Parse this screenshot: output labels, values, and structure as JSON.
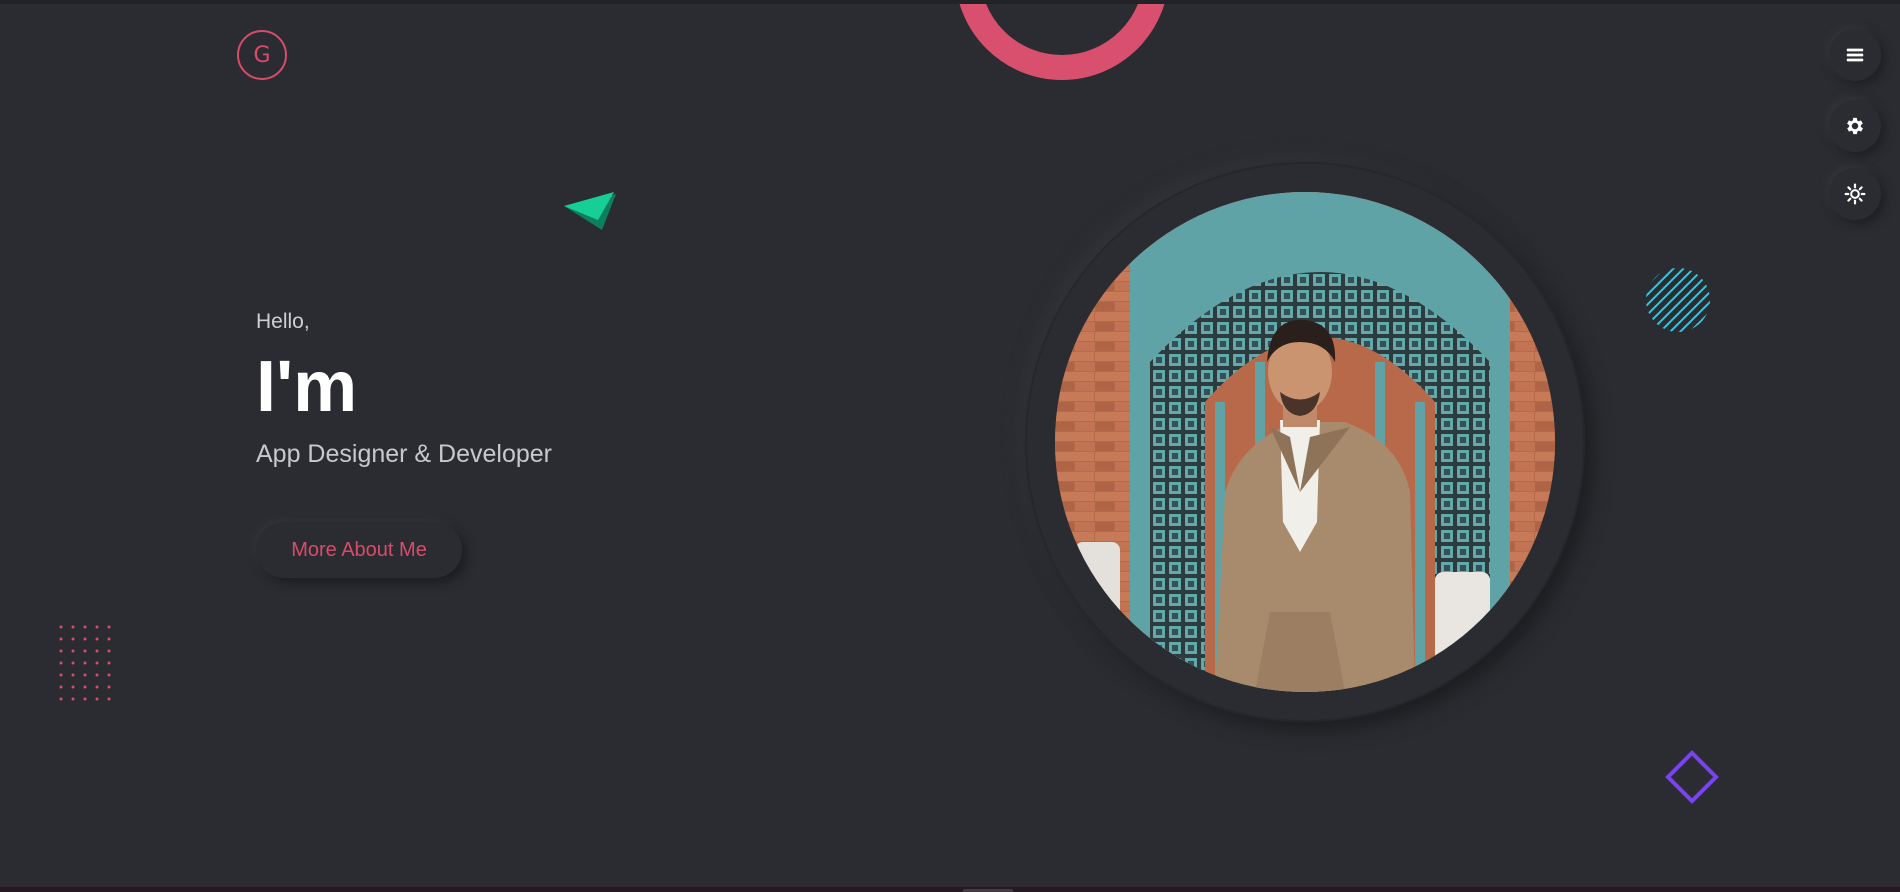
{
  "brand": {
    "logo_letter": "G",
    "accent_color": "#d64c6a"
  },
  "side_controls": [
    {
      "id": "menu",
      "icon": "hamburger-menu-icon"
    },
    {
      "id": "settings",
      "icon": "gear-icon"
    },
    {
      "id": "theme",
      "icon": "sun-icon"
    }
  ],
  "hero": {
    "greeting": "Hello,",
    "headline": "I'm",
    "role": "App Designer & Developer",
    "cta_label": "More About Me"
  },
  "portrait": {
    "alt": "Portrait photo"
  },
  "colors": {
    "background": "#2b2c31",
    "ring": "#d9506e",
    "triangle": "#14c48f",
    "stripes": "#3ec4d9",
    "diamond": "#7a43f2",
    "dots": "#d64c6a"
  }
}
